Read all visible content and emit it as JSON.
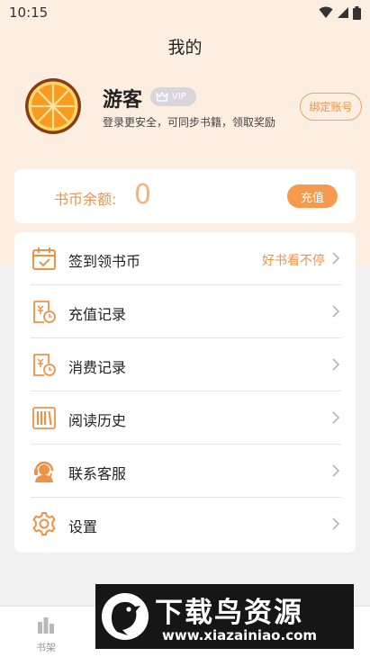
{
  "status_bar": {
    "time": "10:15",
    "icons": [
      "wifi-icon",
      "signal-icon",
      "battery-icon"
    ]
  },
  "header": {
    "title": "我的"
  },
  "profile": {
    "username": "游客",
    "vip_label": "VIP",
    "subtitle": "登录更安全，可同步书籍，领取奖励",
    "bind_button": "绑定账号"
  },
  "coins": {
    "label": "书币余额:",
    "value": "0",
    "recharge_button": "充值"
  },
  "menu": {
    "items": [
      {
        "label": "签到领书币",
        "icon": "calendar-check-icon",
        "extra": "好书看不停"
      },
      {
        "label": "充值记录",
        "icon": "recharge-record-icon",
        "extra": ""
      },
      {
        "label": "消费记录",
        "icon": "consume-record-icon",
        "extra": ""
      },
      {
        "label": "阅读历史",
        "icon": "books-icon",
        "extra": ""
      },
      {
        "label": "联系客服",
        "icon": "headset-icon",
        "extra": ""
      },
      {
        "label": "设置",
        "icon": "gear-icon",
        "extra": ""
      }
    ]
  },
  "tab_bar": {
    "tabs": [
      {
        "label": "书架",
        "icon": "bookshelf-icon"
      }
    ]
  },
  "watermark": {
    "title": "下载鸟资源",
    "url": "www.xiazainiao.com"
  },
  "colors": {
    "accent": "#f79a4e",
    "top_background": "#fdeee2",
    "page_background": "#f1f1f1"
  }
}
